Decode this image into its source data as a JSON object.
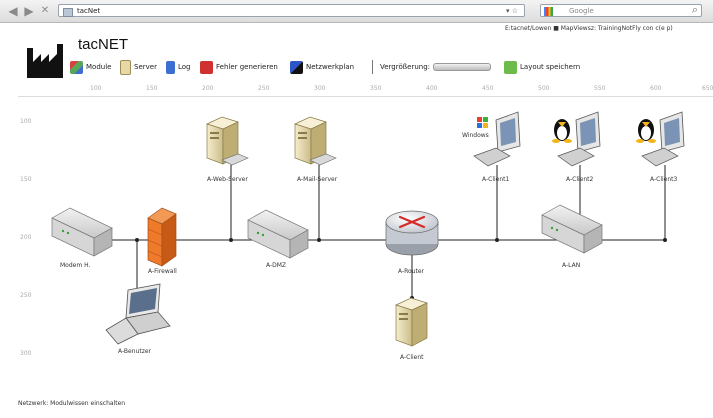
{
  "browser": {
    "url": "tacNet",
    "search_placeholder": "Google",
    "status_text": "E:tacnet/Lowen  ■ MapViewsz: TrainingNotFly con c(e p)"
  },
  "app": {
    "title": "tacNET"
  },
  "toolbar": {
    "items": [
      {
        "label": "Module",
        "icon": "module-icon",
        "color": "#5aa65a"
      },
      {
        "label": "Server",
        "icon": "server-icon",
        "color": "#e7d8a4"
      },
      {
        "label": "Log",
        "icon": "log-icon",
        "color": "#3c6fd0"
      },
      {
        "label": "Fehler generieren",
        "icon": "error-icon",
        "color": "#cf3030"
      },
      {
        "label": "Netzwerkplan",
        "icon": "network-icon",
        "color": "#2d55c8"
      }
    ],
    "view_label": "Vergrößerung:",
    "layout_label": "Layout speichern",
    "layout_color": "#6dbb4a"
  },
  "ruler": {
    "x_labels": [
      "100",
      "150",
      "200",
      "250",
      "300",
      "350",
      "400",
      "450",
      "500",
      "550",
      "600",
      "650"
    ],
    "y_labels": [
      "100",
      "150",
      "200",
      "250",
      "300"
    ]
  },
  "nodes": {
    "modem": "Modem H.",
    "firewall": "A-Firewall",
    "laptop": "A-Benutzer",
    "web_server": "A-Web-Server",
    "mail_server": "A-Mail-Server",
    "switch_dmz": "A-DMZ",
    "router": "A-Router",
    "intranet_pc": "A-Client",
    "switch_lan": "A-LAN",
    "client_win": "A-Client1",
    "client_linux1": "A-Client2",
    "client_linux2": "A-Client3",
    "windows_text": "Windows"
  },
  "status": "Netzwerk: Modulwissen einschalten"
}
